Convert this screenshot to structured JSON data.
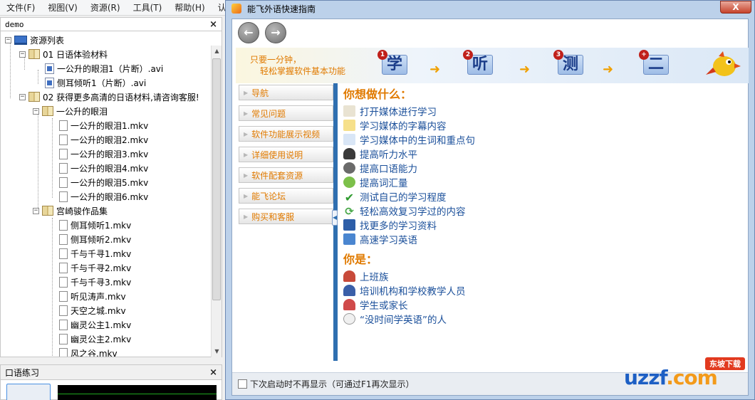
{
  "menubar": {
    "items": [
      "文件(F)",
      "视图(V)",
      "资源(R)",
      "工具(T)",
      "帮助(H)",
      "认证("
    ]
  },
  "left_panel": {
    "title": "demo",
    "close": "×",
    "tree": {
      "root": "资源列表",
      "group1": "01 日语体验材料",
      "g1_files": [
        "一公升的眼泪1（片断）.avi",
        "侧耳倾听1（片断）.avi"
      ],
      "group2": "02 获得更多高清的日语材料,请咨询客服!",
      "sub1": "一公升的眼泪",
      "sub1_files": [
        "一公升的眼泪1.mkv",
        "一公升的眼泪2.mkv",
        "一公升的眼泪3.mkv",
        "一公升的眼泪4.mkv",
        "一公升的眼泪5.mkv",
        "一公升的眼泪6.mkv"
      ],
      "sub2": "宫崎骏作品集",
      "sub2_files": [
        "侧耳倾听1.mkv",
        "侧耳倾听2.mkv",
        "千与千寻1.mkv",
        "千与千寻2.mkv",
        "千与千寻3.mkv",
        "听见涛声.mkv",
        "天空之城.mkv",
        "幽灵公主1.mkv",
        "幽灵公主2.mkv",
        "风之谷.mkv"
      ]
    }
  },
  "speaking_panel": {
    "title": "口语练习",
    "close": "×"
  },
  "guide_window": {
    "title": "能飞外语快速指南",
    "close": "X",
    "nav": {
      "back": "←",
      "forward": "→"
    },
    "banner": {
      "line1": "只要一分钟，",
      "line2": "轻松掌握软件基本功能",
      "steps": [
        {
          "num": "1",
          "char": "学"
        },
        {
          "num": "2",
          "char": "听"
        },
        {
          "num": "3",
          "char": "测"
        },
        {
          "num": "+",
          "char": "二"
        }
      ]
    },
    "sidebar": [
      "导航",
      "常见问题",
      "软件功能展示视频",
      "详细使用说明",
      "软件配套资源",
      "能飞论坛",
      "购买和客服"
    ],
    "heading1": "你想做什么：",
    "actions": [
      {
        "label": "打开媒体进行学习",
        "icon": "book-icon",
        "color": "#e9e3d2"
      },
      {
        "label": "学习媒体的字幕内容",
        "icon": "note-icon",
        "color": "#f6e08a"
      },
      {
        "label": "学习媒体中的生词和重点句",
        "icon": "question-icon",
        "color": "#d9e6f6"
      },
      {
        "label": "提高听力水平",
        "icon": "headphones-icon",
        "color": "#3a3a3a"
      },
      {
        "label": "提高口语能力",
        "icon": "microphone-icon",
        "color": "#6a6a6a"
      },
      {
        "label": "提高词汇量",
        "icon": "frog-icon",
        "color": "#7cc04a"
      },
      {
        "label": "测试自己的学习程度",
        "icon": "check-icon",
        "color": "#2f9b2f"
      },
      {
        "label": "轻松高效复习学过的内容",
        "icon": "refresh-icon",
        "color": "#4aa84a"
      },
      {
        "label": "找更多的学习资料",
        "icon": "film-icon",
        "color": "#2d5ea8"
      },
      {
        "label": "高速学习英语",
        "icon": "card-icon",
        "color": "#4a86d0"
      }
    ],
    "heading2": "你是：",
    "roles": [
      {
        "label": "上班族",
        "icon": "office-worker-icon",
        "color": "#c84a3a"
      },
      {
        "label": "培训机构和学校教学人员",
        "icon": "teacher-icon",
        "color": "#3a5fa8"
      },
      {
        "label": "学生或家长",
        "icon": "family-icon",
        "color": "#d04a4a"
      },
      {
        "label": "“没时间学英语”的人",
        "icon": "clock-icon",
        "color": "#f0f0f0"
      }
    ],
    "footer_checkbox": "下次启动时不再显示（可通过F1再次显示）"
  },
  "watermark": {
    "badge": "东坡下载",
    "text_a": "uzzf",
    "text_b": ".com"
  }
}
